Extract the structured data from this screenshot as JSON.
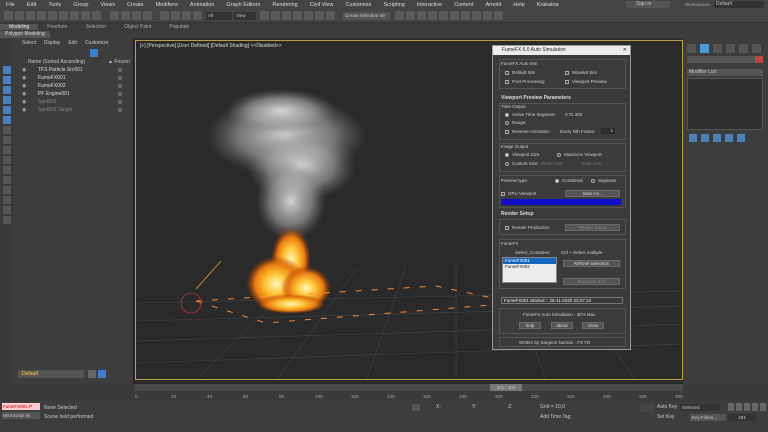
{
  "menu": [
    "File",
    "Edit",
    "Tools",
    "Group",
    "Views",
    "Create",
    "Modifiers",
    "Animation",
    "Graph Editors",
    "Rendering",
    "Civil View",
    "Customize",
    "Scripting",
    "Interactive",
    "Content",
    "Arnold",
    "Help",
    "Krakatoa"
  ],
  "account": {
    "user": "Sign in",
    "workspaces_label": "Workspaces:",
    "workspace": "Default"
  },
  "toolbar": {
    "filter": "All",
    "view": "View",
    "selection_set": "Create Selection Se"
  },
  "ribbon": {
    "tabs": [
      "Modeling",
      "Freeform",
      "Selection",
      "Object Paint",
      "Populate"
    ],
    "subtab": "Polygon Modeling"
  },
  "scene": {
    "tabs": [
      "Select",
      "Display",
      "Edit",
      "Customize"
    ],
    "header": "Name (Sorted Ascending)",
    "frozen_col": "▲ Frozen",
    "items": [
      {
        "name": "TFS Particle Src001",
        "dim": false
      },
      {
        "name": "FumeFX001",
        "dim": false
      },
      {
        "name": "FumeFX002",
        "dim": false
      },
      {
        "name": "PF Engine001",
        "dim": false
      },
      {
        "name": "Spot001",
        "dim": true
      },
      {
        "name": "Spot001.Target",
        "dim": true
      }
    ],
    "layer": "Default"
  },
  "viewport": {
    "label": "[+] [Perspective] [User Defined] [Default Shading] <<Disabled>>"
  },
  "dialog": {
    "title": "FumeFX 5.0 Auto Simulation",
    "auto_sim_header": "FumeFX Auto Sim",
    "default_sim": "Default Sim",
    "wavelet_sim": "Wavelet Sim",
    "post_processing": "Post Processing",
    "viewport_preview": "Viewport Preview",
    "vpp_header": "Viewport Preview Parameters",
    "time_output": "Time Output",
    "active_time": "Active Time Segment:",
    "active_range": "0 To 300",
    "range": "Range:",
    "reverse": "Reverse Animation",
    "every_nth": "Every Nth Frame:",
    "nth_value": "1",
    "image_output": "Image Output",
    "viewport_size": "Viewport Size",
    "maximize": "Maximize Viewport",
    "custom_size": "Custom Size:",
    "width_label": "Width:",
    "width_value": "320",
    "height_label": "Hight:",
    "height_value": "240",
    "preview_type": "Preview type:",
    "combined": "Combined",
    "separate": "Separate",
    "gpu_viewport": "GPU Viewport",
    "save_as": "Save As...",
    "render_header": "Render Setup",
    "render_production": "Render Production",
    "render_setup_btn": "Render Setup",
    "fumefx_label": "FumeFX",
    "select_container": "Select_Container:",
    "ctrl_hint": "Ctrl + Select multiple",
    "containers": [
      "FumeFX001",
      "FumeFX002"
    ],
    "refresh_selection": "Refresh Selection",
    "run_auto_sim": "Run Auto Sim",
    "status_line": "FumeFX001 Started :: 25-11-2020 22:27:13",
    "footer_title": "FumeFX Auto Simulation - 3D's Max",
    "help_btn": "help",
    "about_btn": "about",
    "close_btn": "close",
    "credit": "Written by Sargeon Naman - FX TD"
  },
  "modifier_list": "Modifier List",
  "timeline": {
    "frame": "201 / 300",
    "ticks": [
      "0",
      "20",
      "40",
      "60",
      "80",
      "100",
      "120",
      "140",
      "160",
      "180",
      "200",
      "220",
      "240",
      "260",
      "280",
      "300"
    ]
  },
  "status": {
    "listener_top": "FumeFX001.P",
    "listener_bottom": "MAXScript Mi",
    "selected": "None Selected",
    "prompt": "Scene held performed",
    "x_label": "X:",
    "y_label": "Y:",
    "z_label": "Z:",
    "grid": "Grid = 10,0",
    "add_time_tag": "Add Time Tag",
    "auto_key": "Auto Key",
    "selected_dd": "Selected",
    "set_key": "Set Key",
    "key_filters": "Key Filters...",
    "frame_field": "201"
  },
  "colors": {
    "accent": "#ffd24a",
    "panel": "#3d3d3d",
    "progress": "#1010c8"
  }
}
